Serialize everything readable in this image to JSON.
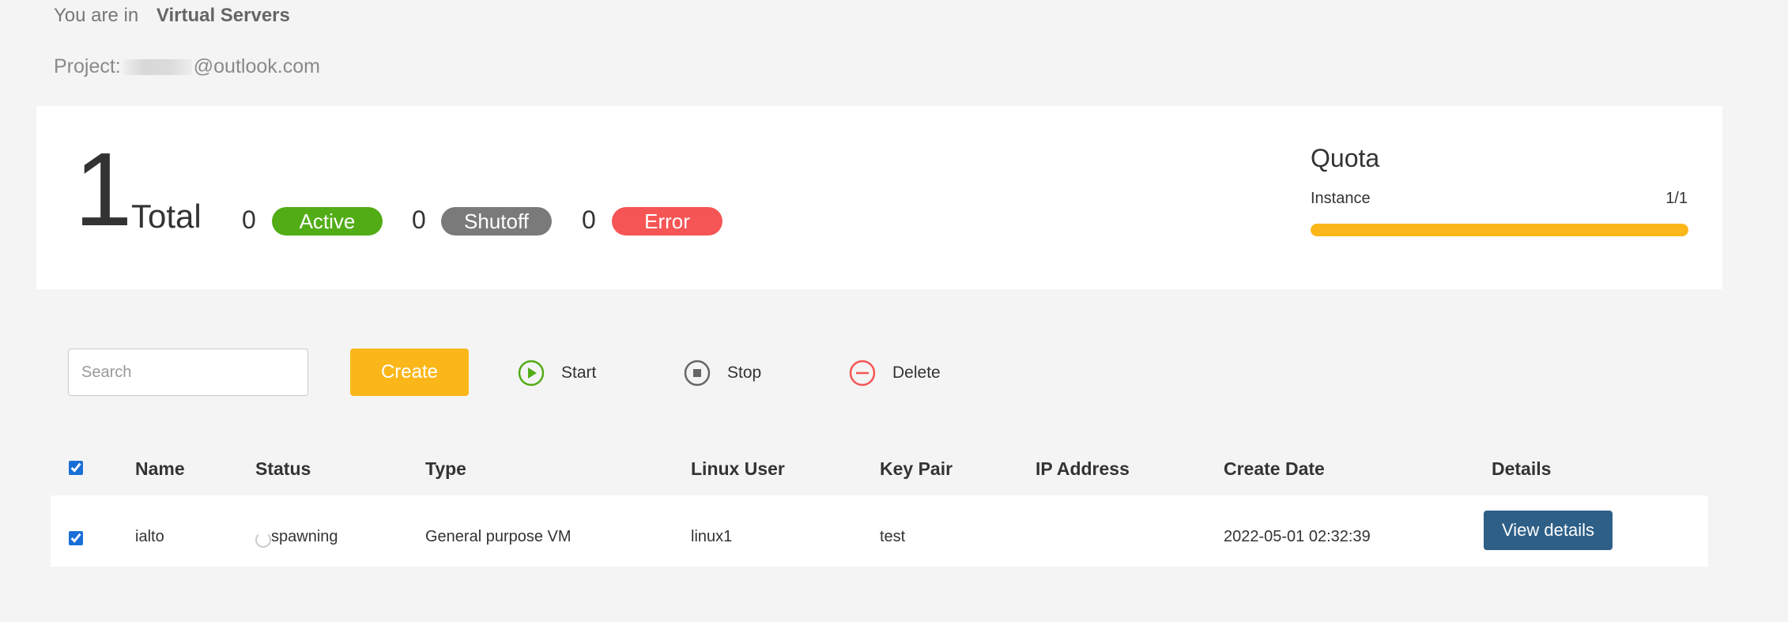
{
  "breadcrumb": {
    "prefix": "You are in",
    "current": "Virtual Servers"
  },
  "project": {
    "label": "Project:",
    "email_suffix": "@outlook.com"
  },
  "summary": {
    "total_count": "1",
    "total_label": "Total",
    "active": {
      "count": "0",
      "label": "Active",
      "color": "#52ac16"
    },
    "shutoff": {
      "count": "0",
      "label": "Shutoff",
      "color": "#7a7a7a"
    },
    "error": {
      "count": "0",
      "label": "Error",
      "color": "#f55555"
    }
  },
  "quota": {
    "title": "Quota",
    "instance_label": "Instance",
    "instance_value": "1/1",
    "fill_fraction": 1.0,
    "color": "#fbb71a"
  },
  "toolbar": {
    "search_placeholder": "Search",
    "create_label": "Create",
    "start_label": "Start",
    "stop_label": "Stop",
    "delete_label": "Delete"
  },
  "table": {
    "headers": [
      "Name",
      "Status",
      "Type",
      "Linux User",
      "Key Pair",
      "IP Address",
      "Create Date",
      "Details"
    ],
    "rows": [
      {
        "name": "ialto",
        "status": "spawning",
        "type": "General purpose VM",
        "linux_user": "linux1",
        "key_pair": "test",
        "ip_address": "",
        "create_date": "2022-05-01 02:32:39",
        "details_label": "View details"
      }
    ]
  }
}
